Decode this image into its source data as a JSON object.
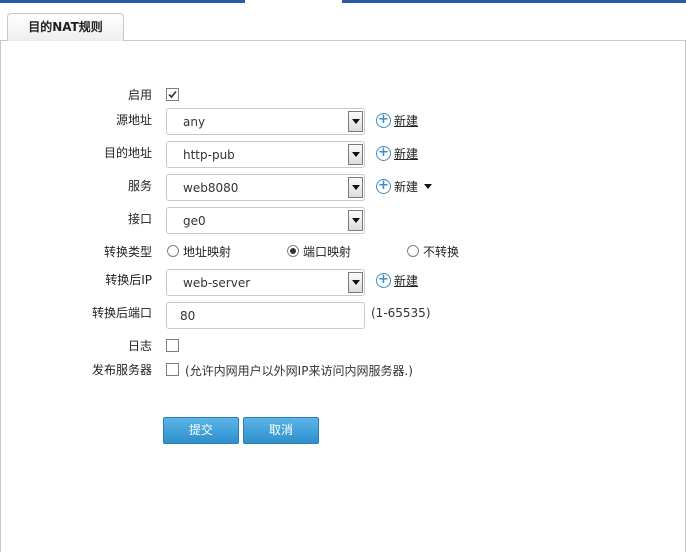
{
  "tab": {
    "title": "目的NAT规则"
  },
  "form": {
    "enable": {
      "label": "启用",
      "checked": true
    },
    "source_address": {
      "label": "源地址",
      "value": "any",
      "new_label": "新建"
    },
    "dest_address": {
      "label": "目的地址",
      "value": "http-pub",
      "new_label": "新建"
    },
    "service": {
      "label": "服务",
      "value": "web8080",
      "new_label": "新建"
    },
    "interface": {
      "label": "接口",
      "value": "ge0"
    },
    "translate_type": {
      "label": "转换类型",
      "options": [
        {
          "label": "地址映射",
          "selected": false
        },
        {
          "label": "端口映射",
          "selected": true
        },
        {
          "label": "不转换",
          "selected": false
        }
      ]
    },
    "translated_ip": {
      "label": "转换后IP",
      "value": "web-server",
      "new_label": "新建"
    },
    "translated_port": {
      "label": "转换后端口",
      "value": "80",
      "hint": "(1-65535)"
    },
    "log": {
      "label": "日志",
      "checked": false
    },
    "publish_server": {
      "label": "发布服务器",
      "checked": false,
      "hint": "(允许内网用户以外网IP来访问内网服务器.)"
    }
  },
  "buttons": {
    "submit": "提交",
    "cancel": "取消"
  },
  "colors": {
    "accent": "#2a5ca6",
    "button": "#3b9ad9",
    "link_icon": "#3b8dc3"
  }
}
